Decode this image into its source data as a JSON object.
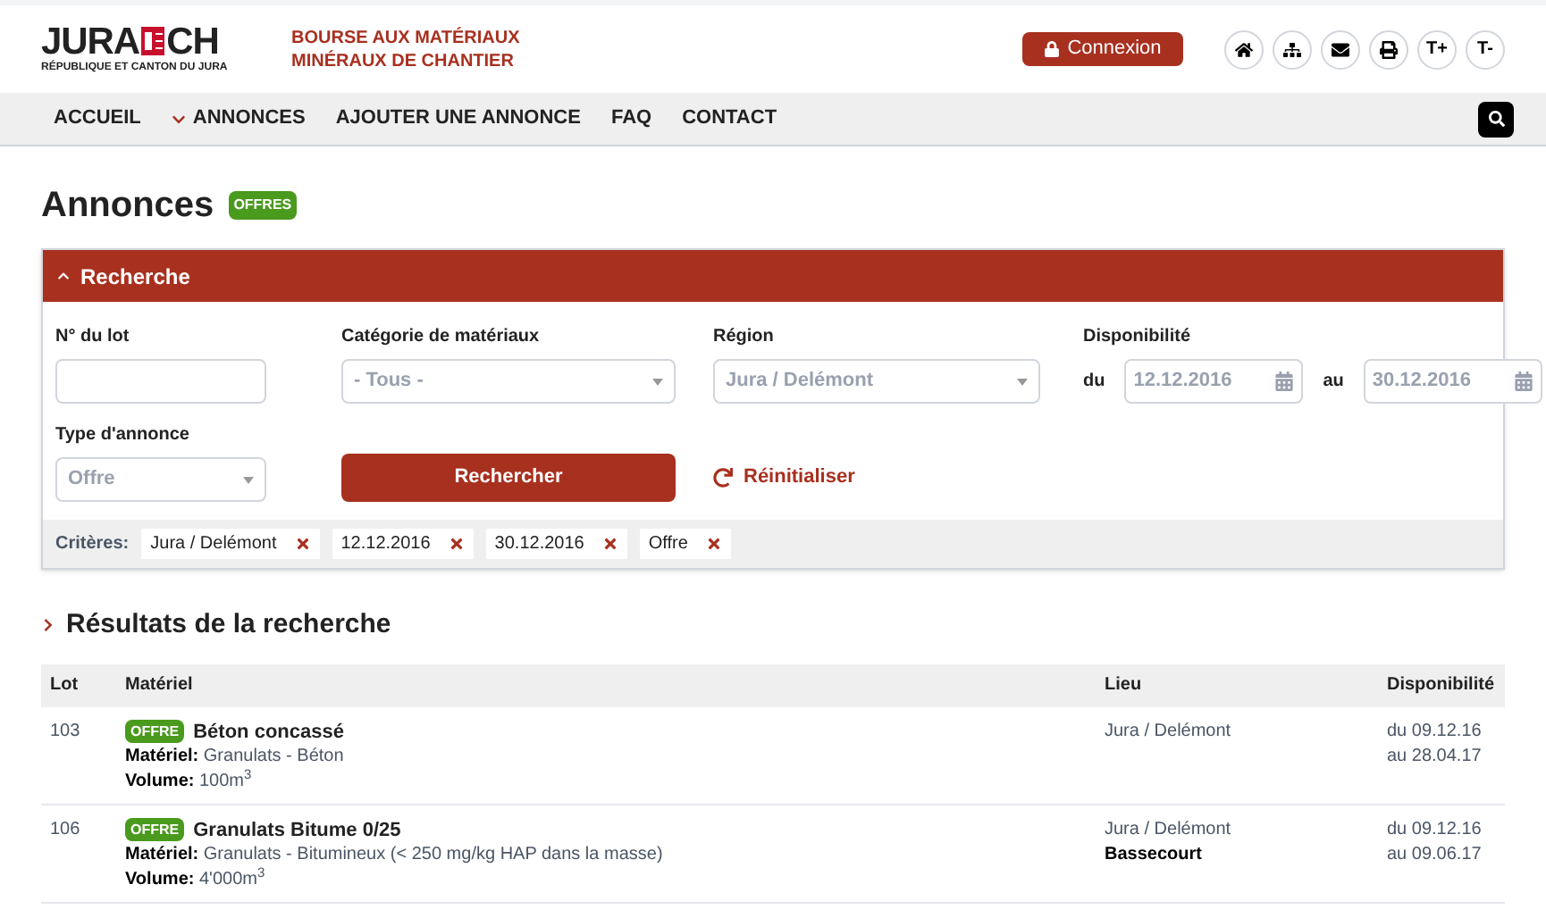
{
  "header": {
    "logo": {
      "left": "JURA",
      "right": "CH",
      "subtitle": "RÉPUBLIQUE ET CANTON DU JURA"
    },
    "tagline": [
      "BOURSE AUX MATÉRIAUX",
      "MINÉRAUX DE CHANTIER"
    ],
    "login": "Connexion",
    "tools": [
      {
        "kind": "home"
      },
      {
        "kind": "sitemap"
      },
      {
        "kind": "mail"
      },
      {
        "kind": "print"
      },
      {
        "kind": "text",
        "label": "T+"
      },
      {
        "kind": "text",
        "label": "T-"
      }
    ]
  },
  "nav": {
    "items": [
      {
        "label": "ACCUEIL",
        "kind": "link"
      },
      {
        "label": "ANNONCES",
        "kind": "dropdown"
      },
      {
        "label": "AJOUTER UNE ANNONCE",
        "kind": "link"
      },
      {
        "label": "FAQ",
        "kind": "link"
      },
      {
        "label": "CONTACT",
        "kind": "link"
      }
    ]
  },
  "page": {
    "title": "Annonces",
    "badge": "OFFRES"
  },
  "search": {
    "title": "Recherche",
    "expanded": true,
    "lot": {
      "label": "N° du lot"
    },
    "category": {
      "label": "Catégorie de matériaux",
      "value": "- Tous -"
    },
    "region": {
      "label": "Région",
      "value": "Jura / Delémont"
    },
    "availability": {
      "label": "Disponibilité",
      "from_label": "du",
      "from": "12.12.2016",
      "to_label": "au",
      "to": "30.12.2016"
    },
    "type": {
      "label": "Type d'annonce",
      "value": "Offre"
    },
    "submit": "Rechercher",
    "reset": "Réinitialiser",
    "criteria_label": "Critères:",
    "criteria": [
      "Jura / Delémont",
      "12.12.2016",
      "30.12.2016",
      "Offre"
    ]
  },
  "results": {
    "title": "Résultats de la recherche",
    "columns": [
      "Lot",
      "Matériel",
      "Lieu",
      "Disponibilité"
    ],
    "rows": [
      {
        "lot": "103",
        "badge": "OFFRE",
        "title": "Béton concassé",
        "material_label": "Matériel:",
        "material": "Granulats - Béton",
        "volume_label": "Volume:",
        "volume": "100m$^{3}$",
        "place": [
          "Jura / Delémont"
        ],
        "dates": [
          "du 09.12.16",
          "au 28.04.17"
        ]
      },
      {
        "lot": "106",
        "badge": "OFFRE",
        "title": "Granulats Bitume 0/25",
        "material_label": "Matériel:",
        "material": "Granulats - Bitumineux (< 250 mg/kg HAP dans la masse)",
        "volume_label": "Volume:",
        "volume": "4'000m$^{3}$",
        "place": [
          "Jura / Delémont",
          "**Bassecourt**"
        ],
        "dates": [
          "du 09.12.16",
          "au 09.06.17"
        ]
      }
    ]
  }
}
